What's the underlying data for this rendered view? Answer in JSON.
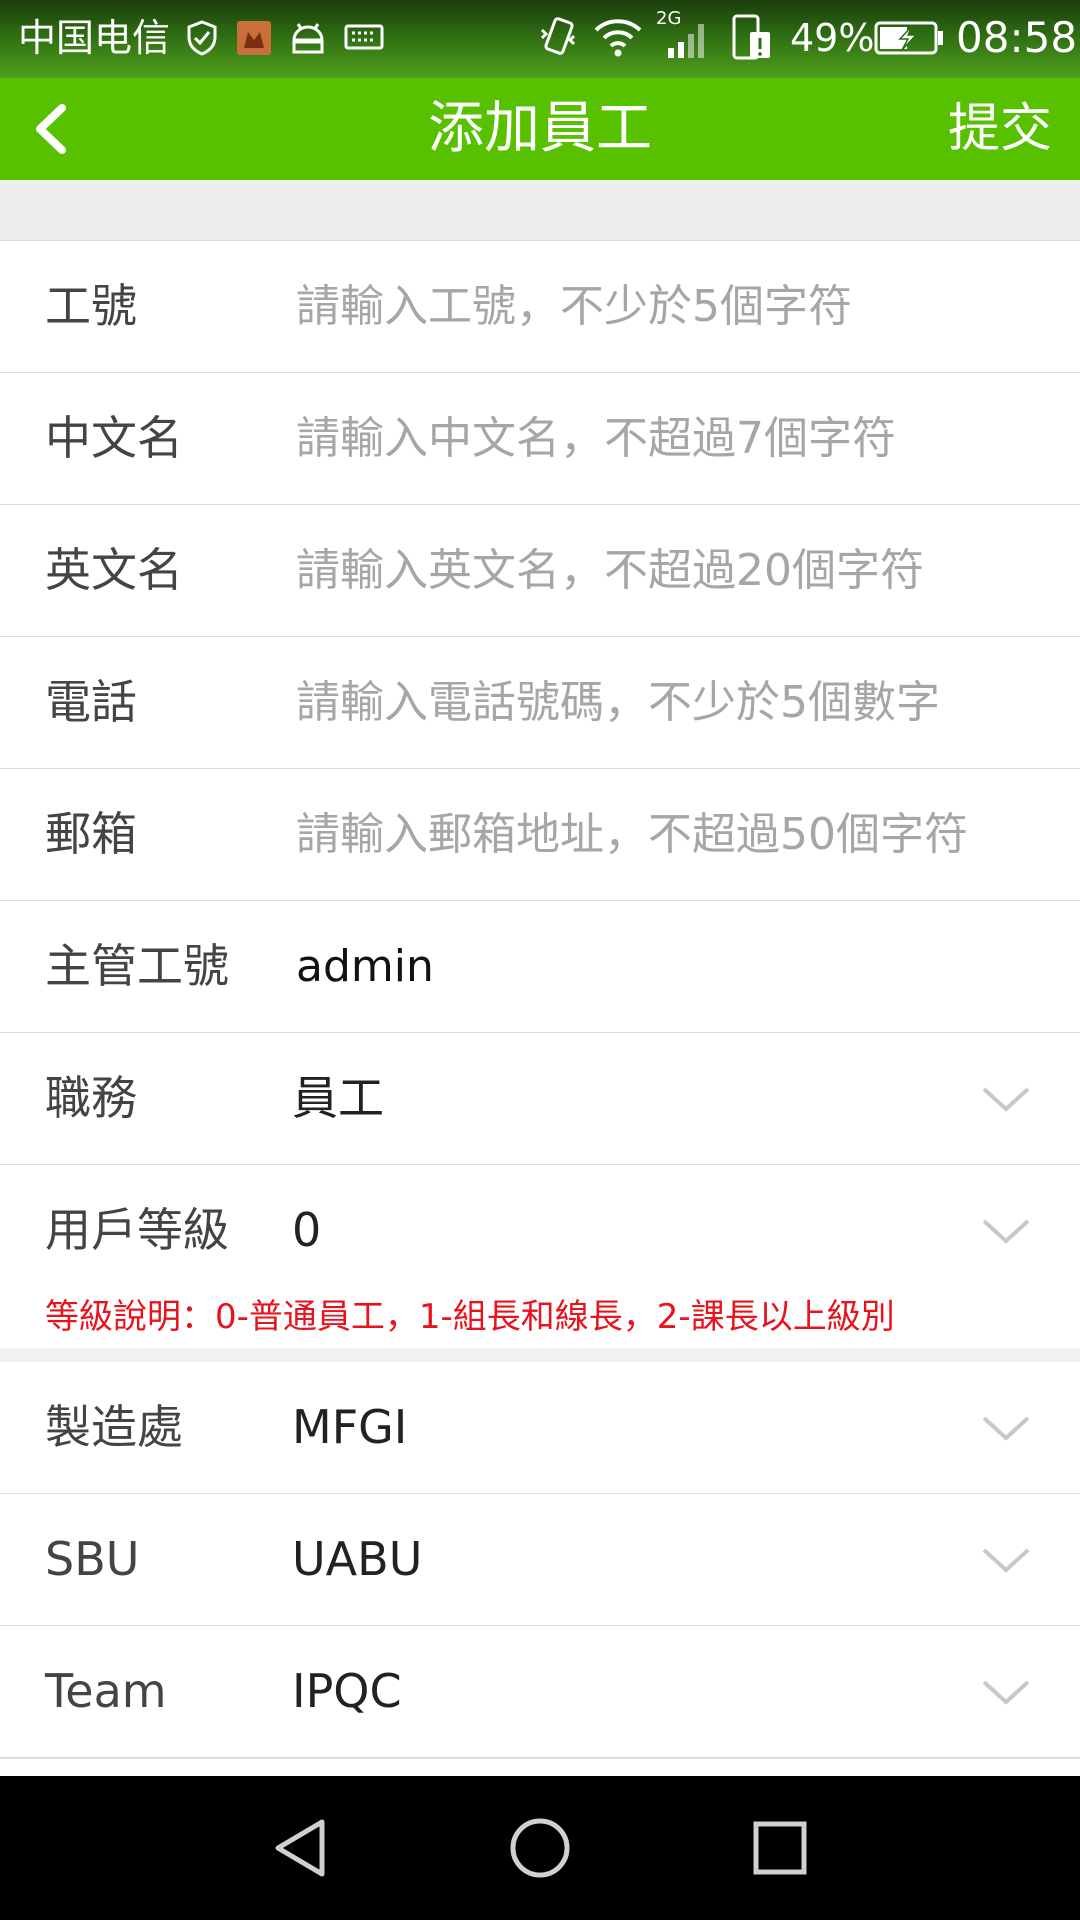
{
  "status_bar": {
    "carrier": "中国电信",
    "network": "2G",
    "battery": "49%",
    "time": "08:58"
  },
  "app_bar": {
    "back_icon": "chevron-left-icon",
    "title": "添加員工",
    "submit_label": "提交"
  },
  "form": {
    "employee_id": {
      "label": "工號",
      "placeholder": "請輸入工號，不少於5個字符"
    },
    "chinese_name": {
      "label": "中文名",
      "placeholder": "請輸入中文名，不超過7個字符"
    },
    "english_name": {
      "label": "英文名",
      "placeholder": "請輸入英文名，不超過20個字符"
    },
    "phone": {
      "label": "電話",
      "placeholder": "請輸入電話號碼，不少於5個數字"
    },
    "email": {
      "label": "郵箱",
      "placeholder": "請輸入郵箱地址，不超過50個字符"
    },
    "supervisor_id": {
      "label": "主管工號",
      "value": "admin"
    },
    "position": {
      "label": "職務",
      "value": "員工"
    },
    "user_level": {
      "label": "用戶等級",
      "value": "0",
      "note": "等級說明：0-普通員工，1-組長和線長，2-課長以上級別"
    },
    "factory": {
      "label": "製造處",
      "value": "MFGI"
    },
    "sbu": {
      "label": "SBU",
      "value": "UABU"
    },
    "team": {
      "label": "Team",
      "value": "IPQC"
    }
  },
  "nav_bar": [
    "back-triangle-icon",
    "home-circle-icon",
    "recents-square-icon"
  ],
  "colors": {
    "app_bar": "#57c100",
    "note_text": "#e8141d",
    "placeholder_text": "#a6a6a6",
    "divider": "#dddddd"
  }
}
